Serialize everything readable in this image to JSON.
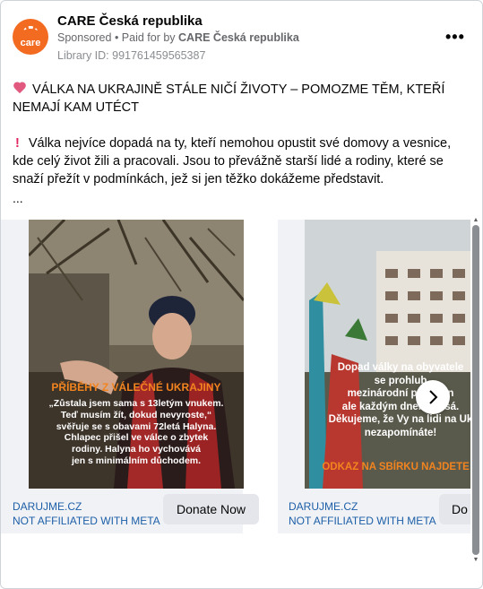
{
  "post": {
    "page_name": "CARE Česká republika",
    "avatar_text": "care",
    "sponsored": "Sponsored",
    "paid_for_prefix": " • Paid for by ",
    "paid_for_name": "CARE Česká republika",
    "library_id": "Library ID: 991761459565387",
    "more_label": "•••",
    "headline": "VÁLKA NA UKRAJINĚ STÁLE NIČÍ ŽIVOTY – POMOZME TĚM, KTEŘÍ NEMAJÍ KAM UTÉCT",
    "body": "Válka nejvíce dopadá na ty, kteří nemohou opustit své domovy a vesnice, kde celý život žili a pracovali. Jsou to převážně starší lidé a rodiny, které se snaží přežít v podmínkách, jež si jen těžko dokážeme představit.",
    "truncation": "...",
    "icons": {
      "headline": "broken-heart-icon",
      "body": "exclamation-icon",
      "next": "chevron-right-icon"
    }
  },
  "cards": [
    {
      "image_title": "PŘÍBĚHY Z VÁLEČNÉ UKRAJINY",
      "image_lines": [
        "„Zůstala jsem sama s 13letým vnukem.",
        "Teď musím žít, dokud nevyroste,“",
        "svěřuje se s obavami 72letá Halyna.",
        "Chlapec přišel ve válce o zbytek",
        "rodiny. Halyna ho vychovává",
        "jen s minimálním důchodem."
      ],
      "domain": "DARUJME.CZ",
      "disclaimer": "NOT AFFILIATED WITH META",
      "cta": "Donate Now"
    },
    {
      "image_lines": [
        "Dopad války na obyvatele",
        "se prohlub",
        "mezinárodní po          krajin",
        "ale každým dnem klesá.",
        "Děkujeme, že Vy na lidi na Uk",
        "nezapomínáte!"
      ],
      "image_footer": "ODKAZ NA SBÍRKU NAJDETE V",
      "domain": "DARUJME.CZ",
      "disclaimer": "NOT AFFILIATED WITH META",
      "cta": "Do"
    }
  ],
  "colors": {
    "brand_orange": "#f26b21",
    "accent_orange": "#f2841f",
    "link_blue": "#1d5fa8"
  }
}
